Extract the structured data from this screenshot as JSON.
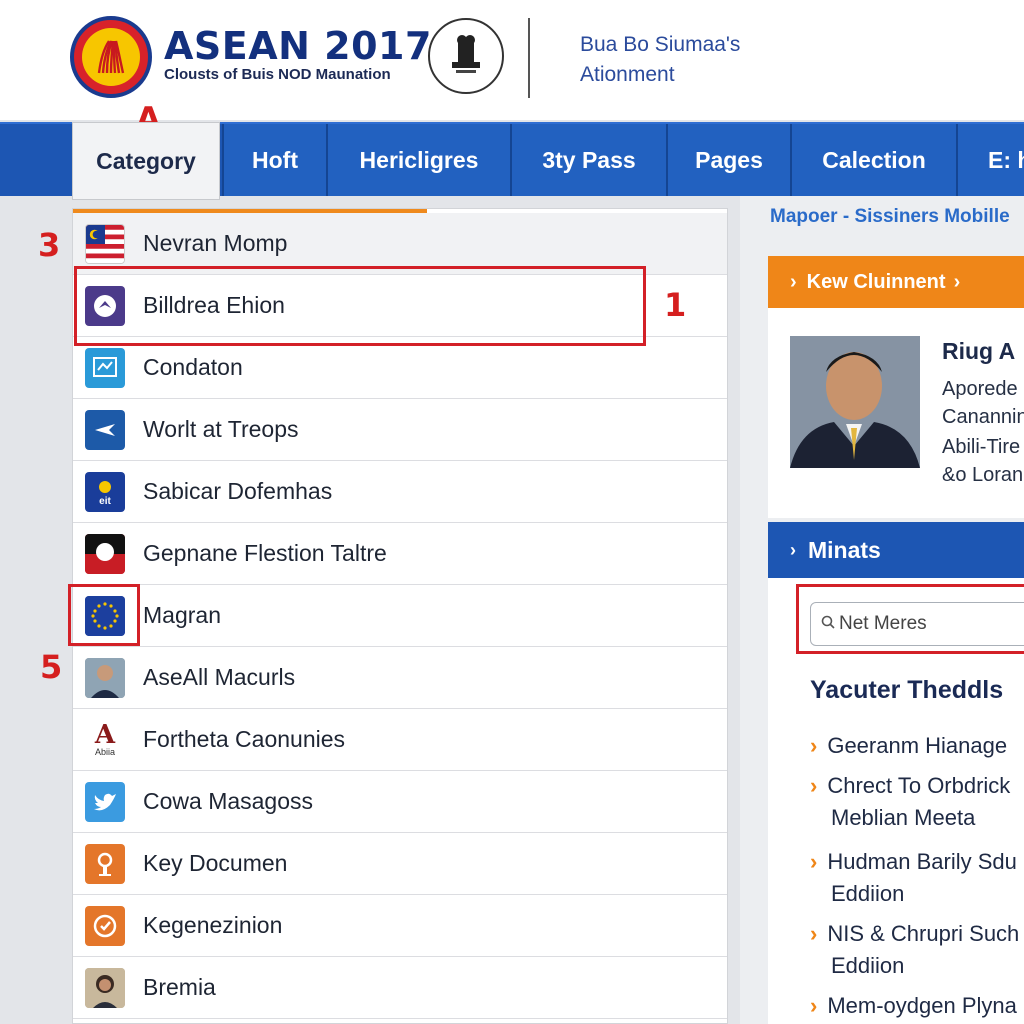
{
  "header": {
    "brand_title": "ASEAN 2017",
    "brand_subtitle": "Clousts of Buis NOD Maunation",
    "right_line1": "Bua Bo Siumaa's",
    "right_line2": "Ationment"
  },
  "annotations": {
    "a": "A",
    "one": "1",
    "three": "3",
    "five": "5"
  },
  "nav": {
    "tabs": [
      {
        "label": "Category"
      },
      {
        "label": "Hoft"
      },
      {
        "label": "Hericligres"
      },
      {
        "label": "3ty Pass"
      },
      {
        "label": "Pages"
      },
      {
        "label": "Calection"
      },
      {
        "label": "E: h"
      }
    ]
  },
  "list": {
    "items": [
      {
        "label": "Nevran Momp",
        "icon": "malaysia-flag-icon"
      },
      {
        "label": "Billdrea Ehion",
        "icon": "bird-icon"
      },
      {
        "label": "Condaton",
        "icon": "certificate-icon"
      },
      {
        "label": "Worlt at Treops",
        "icon": "plane-icon"
      },
      {
        "label": "Sabicar Dofemhas",
        "icon": "sun-badge-icon"
      },
      {
        "label": "Gepnane Flestion Taltre",
        "icon": "flag-circle-icon"
      },
      {
        "label": "Magran",
        "icon": "eu-flag-icon"
      },
      {
        "label": "AseAll Macurls",
        "icon": "person-photo-icon"
      },
      {
        "label": "Fortheta Caonunies",
        "icon": "abbia-logo-icon"
      },
      {
        "label": "Cowa Masagoss",
        "icon": "twitter-icon"
      },
      {
        "label": "Key Documen",
        "icon": "document-icon"
      },
      {
        "label": "Kegenezinion",
        "icon": "award-icon"
      },
      {
        "label": "Bremia",
        "icon": "woman-photo-icon"
      }
    ],
    "icon_small_text": {
      "sun_badge": "eit",
      "abbia": "Abiia"
    }
  },
  "right": {
    "breadcrumb": "Mapoer - Sissiners Mobille",
    "orange_bar": "Kew Cluinnent",
    "person": {
      "name": "Riug A",
      "line1": "Aporede",
      "line2": "Canannin",
      "line3": "Abili-Tire",
      "line4": "&o Loran"
    },
    "blue_bar": "Minats",
    "search_placeholder": "Net Meres",
    "section_title": "Yacuter Theddls",
    "links": [
      {
        "line1": "Geeranm Hianage",
        "line2": ""
      },
      {
        "line1": "Chrect To Orbdrick",
        "line2": "Meblian Meeta"
      },
      {
        "line1": "Hudman Barily Sdu",
        "line2": "Eddiion"
      },
      {
        "line1": "NIS & Chrupri Such",
        "line2": "Eddiion"
      },
      {
        "line1": "Mem-oydgen Plyna",
        "line2": ""
      }
    ]
  },
  "colors": {
    "nav_blue": "#1d56b3",
    "accent_orange": "#ef8618",
    "annotation_red": "#d51f1f"
  }
}
